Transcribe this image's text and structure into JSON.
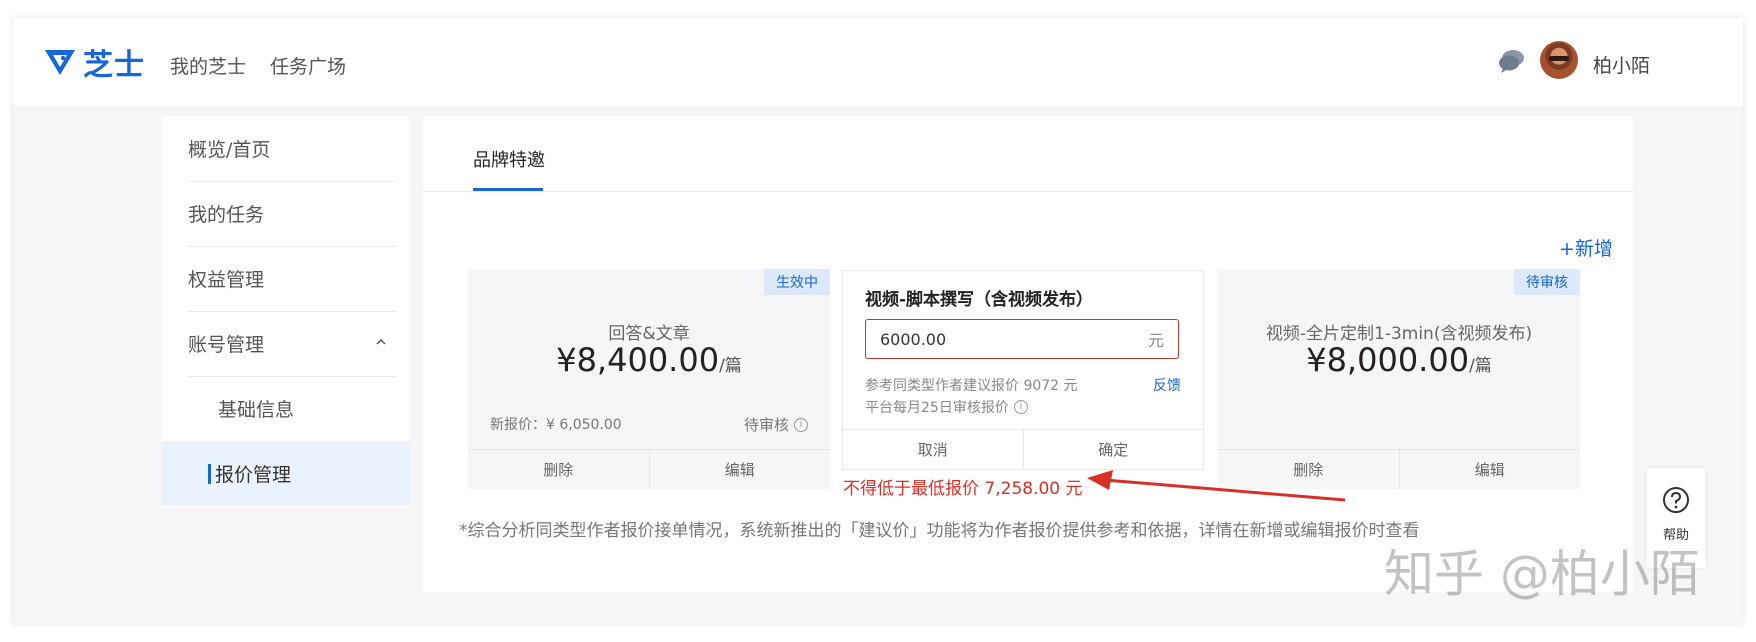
{
  "header": {
    "logo_text": "芝士",
    "nav": [
      "我的芝士",
      "任务广场"
    ],
    "username": "柏小陌"
  },
  "sidebar": {
    "items": [
      {
        "label": "概览/首页"
      },
      {
        "label": "我的任务"
      },
      {
        "label": "权益管理"
      },
      {
        "label": "账号管理"
      },
      {
        "label": "基础信息"
      },
      {
        "label": "报价管理"
      }
    ]
  },
  "main": {
    "tab": "品牌特邀",
    "add_label": "+新增",
    "cards": [
      {
        "badge": "生效中",
        "title": "回答&文章",
        "price": "¥8,400.00",
        "unit": "/篇",
        "new_price": "新报价：¥ 6,050.00",
        "status": "待审核",
        "actions": [
          "删除",
          "编辑"
        ]
      },
      {
        "badge": "待审核",
        "title": "视频-全片定制1-3min(含视频发布)",
        "price": "¥8,000.00",
        "unit": "/篇",
        "actions": [
          "删除",
          "编辑"
        ]
      }
    ],
    "edit_card": {
      "title": "视频-脚本撰写（含视频发布）",
      "input_value": "6000.00",
      "input_suffix": "元",
      "hint1": "参考同类型作者建议报价 9072 元",
      "hint2": "平台每月25日审核报价",
      "feedback": "反馈",
      "cancel": "取消",
      "confirm": "确定"
    },
    "error": "不得低于最低报价 7,258.00 元",
    "footnote": "*综合分析同类型作者报价接单情况，系统新推出的「建议价」功能将为作者报价提供参考和依据，详情在新增或编辑报价时查看"
  },
  "help": {
    "label": "帮助"
  },
  "watermark": "知乎 @柏小陌",
  "colors": {
    "accent": "#1766d8",
    "error": "#d93026",
    "badge_bg": "#dbe9fb"
  }
}
